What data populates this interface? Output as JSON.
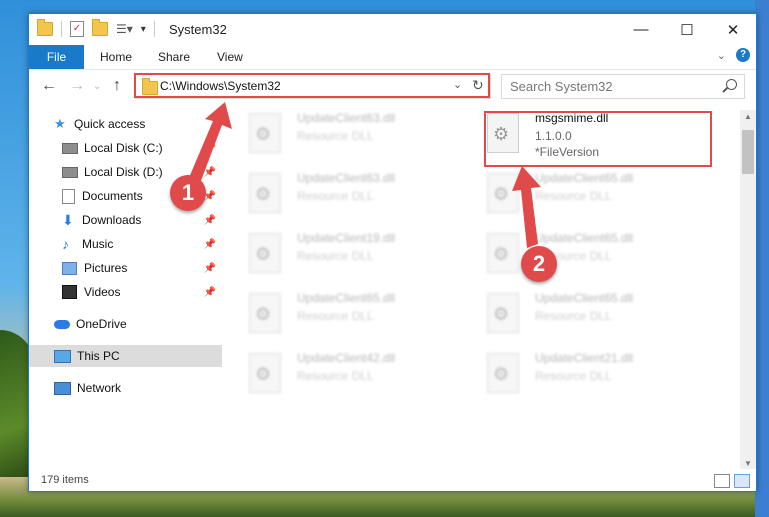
{
  "window": {
    "title": "System32",
    "minimize": "—",
    "maximize": "☐",
    "close": "✕"
  },
  "ribbon": {
    "tabs": [
      "File",
      "Home",
      "Share",
      "View"
    ]
  },
  "navigation": {
    "back": "←",
    "forward": "→",
    "up": "↑",
    "address": "C:\\Windows\\System32",
    "search_placeholder": "Search System32"
  },
  "sidebar": {
    "items": [
      {
        "label": "Quick access",
        "pinned": false
      },
      {
        "label": "Local Disk (C:)",
        "pinned": true
      },
      {
        "label": "Local Disk (D:)",
        "pinned": true
      },
      {
        "label": "Documents",
        "pinned": true
      },
      {
        "label": "Downloads",
        "pinned": true
      },
      {
        "label": "Music",
        "pinned": true
      },
      {
        "label": "Pictures",
        "pinned": true
      },
      {
        "label": "Videos",
        "pinned": true
      },
      {
        "label": "OneDrive",
        "pinned": false
      },
      {
        "label": "This PC",
        "pinned": false,
        "selected": true
      },
      {
        "label": "Network",
        "pinned": false
      }
    ]
  },
  "files": {
    "left_column": [
      {
        "name": "UpdateClient63.dll",
        "type": "Resource DLL"
      },
      {
        "name": "UpdateClient63.dll",
        "type": "Resource DLL"
      },
      {
        "name": "UpdateClient19.dll",
        "type": "Resource DLL"
      },
      {
        "name": "UpdateClient65.dll",
        "type": "Resource DLL"
      },
      {
        "name": "UpdateClient42.dll",
        "type": "Resource DLL"
      }
    ],
    "right_column": [
      {
        "name": "msgsmime.dll",
        "version": "1.1.0.0",
        "description": "*FileVersion"
      },
      {
        "name": "UpdateClient65.dll",
        "type": "Resource DLL"
      },
      {
        "name": "UpdateClient65.dll",
        "type": "Resource DLL"
      },
      {
        "name": "UpdateClient65.dll",
        "type": "Resource DLL"
      },
      {
        "name": "UpdateClient21.dll",
        "type": "Resource DLL"
      }
    ]
  },
  "status": {
    "item_count": "179 items"
  },
  "callouts": {
    "first": "1",
    "second": "2"
  },
  "colors": {
    "accent": "#1979ca",
    "highlight": "#e04a4a"
  }
}
